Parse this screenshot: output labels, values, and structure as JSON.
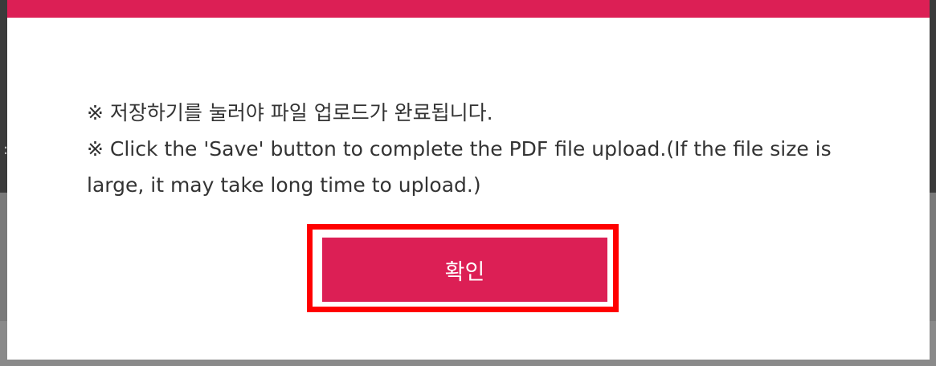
{
  "dialog": {
    "message_line_1": "※ 저장하기를 눌러야 파일 업로드가 완료됩니다.",
    "message_line_2": "※ Click the 'Save' button to complete the PDF file upload.(If the file size is large, it may take long time to upload.)",
    "confirm_label": "확인"
  },
  "colors": {
    "accent": "#dc1f55",
    "highlight_outline": "#ff0000",
    "backdrop": "#3b3b3b",
    "text": "#333333"
  }
}
